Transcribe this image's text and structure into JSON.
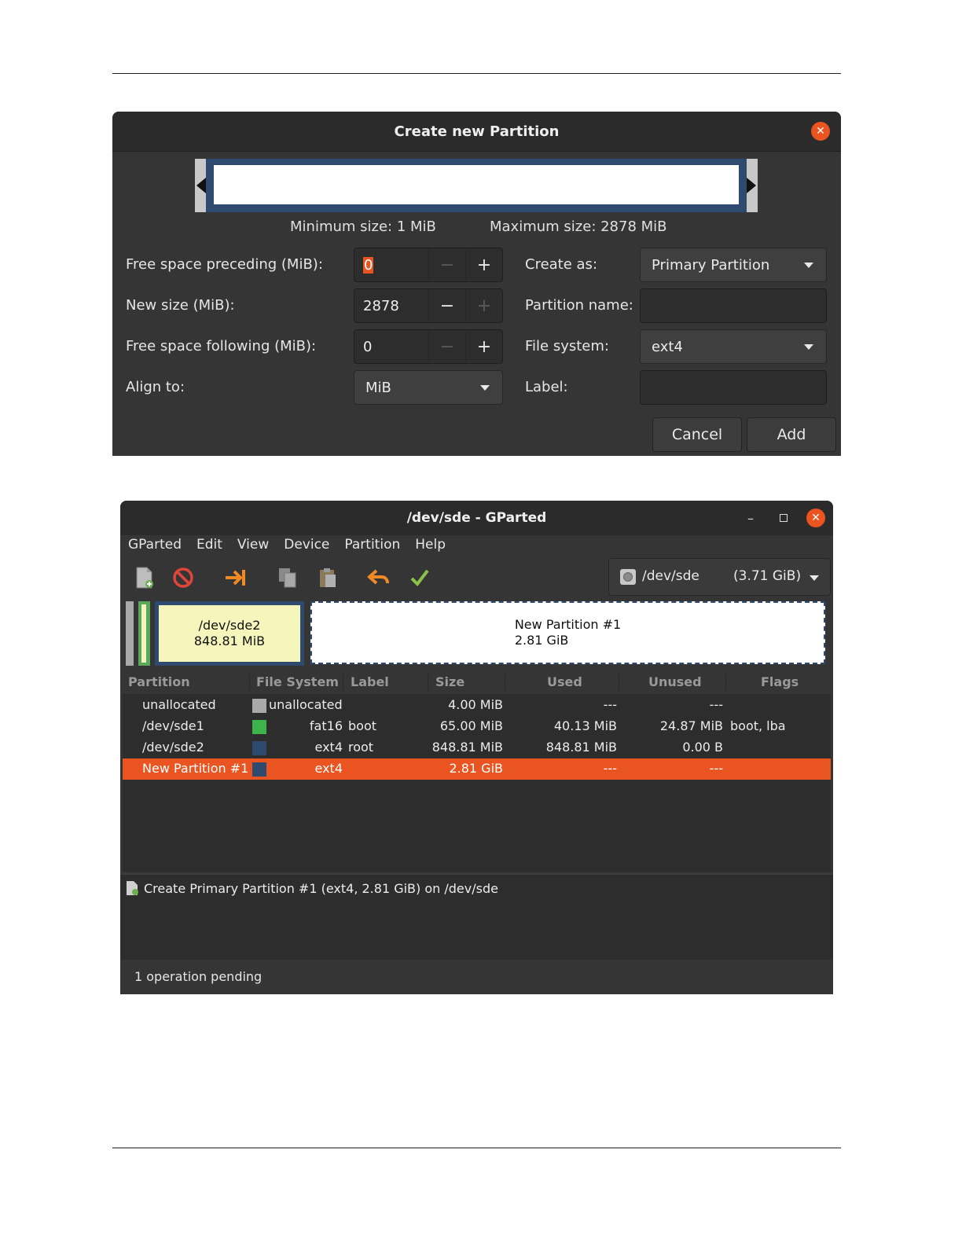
{
  "dialog": {
    "title": "Create new Partition",
    "min_size": "Minimum size: 1 MiB",
    "max_size": "Maximum size: 2878 MiB",
    "labels": {
      "preceding": "Free space preceding (MiB):",
      "new_size": "New size (MiB):",
      "following": "Free space following (MiB):",
      "align": "Align to:",
      "create_as": "Create as:",
      "partition_name": "Partition name:",
      "file_system": "File system:",
      "label": "Label:"
    },
    "values": {
      "preceding": "0",
      "new_size": "2878",
      "following": "0",
      "align": "MiB",
      "create_as": "Primary Partition",
      "partition_name": "",
      "file_system": "ext4",
      "label": ""
    },
    "buttons": {
      "cancel": "Cancel",
      "add": "Add"
    }
  },
  "gparted": {
    "title": "/dev/sde - GParted",
    "menu": [
      "GParted",
      "Edit",
      "View",
      "Device",
      "Partition",
      "Help"
    ],
    "device": {
      "name": "/dev/sde",
      "size": "(3.71 GiB)"
    },
    "map": {
      "sde2_name": "/dev/sde2",
      "sde2_size": "848.81 MiB",
      "new_name": "New Partition #1",
      "new_size": "2.81 GiB"
    },
    "columns": [
      "Partition",
      "File System",
      "Label",
      "Size",
      "Used",
      "Unused",
      "Flags"
    ],
    "rows": [
      {
        "partition": "unallocated",
        "fs": "unallocated",
        "label": "",
        "size": "4.00 MiB",
        "used": "---",
        "unused": "---",
        "flags": "",
        "color": "#a9a9a9"
      },
      {
        "partition": "/dev/sde1",
        "fs": "fat16",
        "label": "boot",
        "size": "65.00 MiB",
        "used": "40.13 MiB",
        "unused": "24.87 MiB",
        "flags": "boot, lba",
        "color": "#3cb44b"
      },
      {
        "partition": "/dev/sde2",
        "fs": "ext4",
        "label": "root",
        "size": "848.81 MiB",
        "used": "848.81 MiB",
        "unused": "0.00 B",
        "flags": "",
        "color": "#2e4a6e"
      },
      {
        "partition": "New Partition #1",
        "fs": "ext4",
        "label": "",
        "size": "2.81 GiB",
        "used": "---",
        "unused": "---",
        "flags": "",
        "color": "#2e4a6e"
      }
    ],
    "operation": "Create Primary Partition #1 (ext4, 2.81 GiB) on /dev/sde",
    "status": "1 operation pending",
    "colors": {
      "accent": "#e95420",
      "ext4": "#2e4a6e",
      "fat16": "#3cb44b"
    }
  }
}
